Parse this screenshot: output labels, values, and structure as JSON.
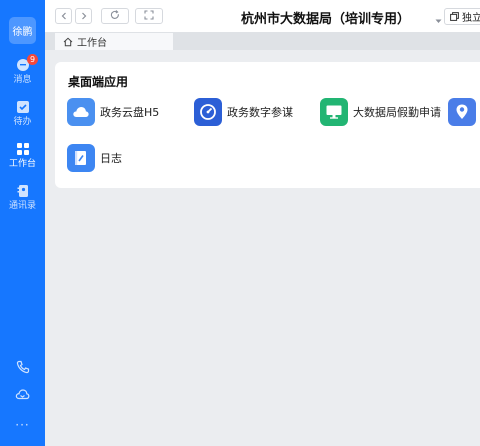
{
  "sidebar": {
    "avatar": "徐鹏",
    "items": [
      {
        "label": "消息",
        "badge": "9",
        "icon": "chat-bubble-icon"
      },
      {
        "label": "待办",
        "icon": "checkbox-icon"
      },
      {
        "label": "工作台",
        "icon": "grid-icon",
        "active": true
      },
      {
        "label": "通讯录",
        "icon": "contacts-icon"
      }
    ],
    "bottom_icons": [
      "phone-icon",
      "cloud-icon",
      "more-icon"
    ],
    "more_glyph": "···"
  },
  "topbar": {
    "title": "杭州市大数据局（培训专用）",
    "standalone_label": "独立"
  },
  "tabs": [
    {
      "label": "工作台"
    }
  ],
  "main": {
    "section_title": "桌面端应用",
    "apps": [
      {
        "label": "政务云盘H5",
        "icon": "cloud-drive-icon",
        "color": "#4a90f0"
      },
      {
        "label": "政务数字参谋",
        "icon": "gauge-icon",
        "color": "#2c5fd6"
      },
      {
        "label": "大数据局假勤申请",
        "icon": "monitor-icon",
        "color": "#22b573"
      },
      {
        "label": "",
        "icon": "location-icon",
        "color": "#4a7de8"
      },
      {
        "label": "日志",
        "icon": "log-icon",
        "color": "#3d86f2"
      }
    ]
  },
  "colors": {
    "sidebar": "#1677ff",
    "badge": "#f5483b",
    "background": "#ebedf0"
  }
}
